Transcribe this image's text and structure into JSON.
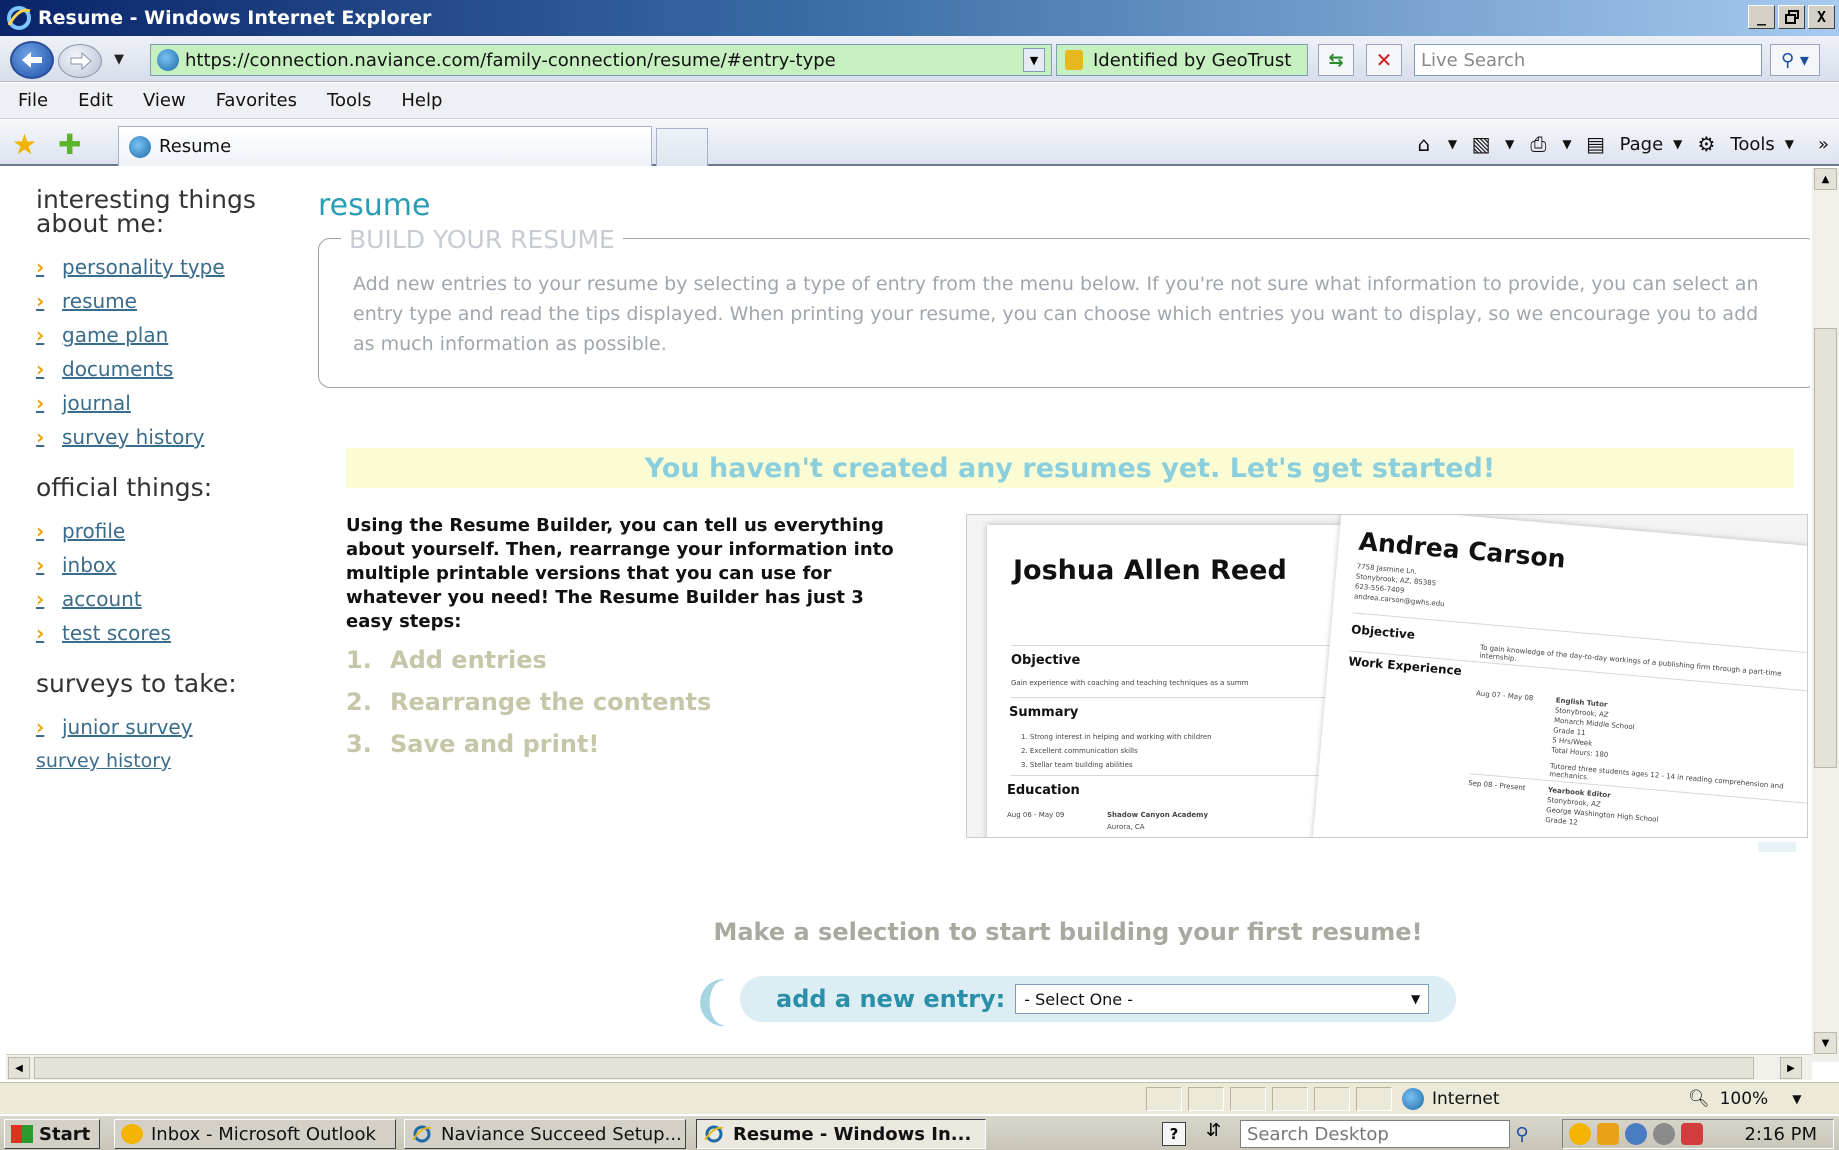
{
  "window": {
    "title": "Resume - Windows Internet Explorer",
    "buttons": {
      "minimize": "_",
      "maximize": "▫",
      "close": "X"
    }
  },
  "address": {
    "url": "https://connection.naviance.com/family-connection/resume/#entry-type",
    "cert": "Identified by GeoTrust",
    "search_placeholder": "Live Search"
  },
  "menu": [
    "File",
    "Edit",
    "View",
    "Favorites",
    "Tools",
    "Help"
  ],
  "tabbar": {
    "tab_label": "Resume",
    "page_label": "Page",
    "tools_label": "Tools",
    "overflow": "»"
  },
  "sidebar": {
    "heading_interesting": "interesting things about me:",
    "interesting": [
      "personality type",
      "resume",
      "game plan",
      "documents",
      "journal",
      "survey history"
    ],
    "heading_official": "official things:",
    "official": [
      "profile",
      "inbox",
      "account",
      "test scores"
    ],
    "heading_surveys": "surveys to take:",
    "surveys": [
      "junior survey"
    ],
    "survey_history_link": "survey history"
  },
  "main": {
    "heading": "resume",
    "build_legend": "BUILD YOUR RESUME",
    "build_text": "Add new entries to your resume by selecting a type of entry from the menu below. If you're not sure what information to provide, you can select an entry type and read the tips displayed. When printing your resume, you can choose which entries you want to display, so we encourage you to add as much information as possible.",
    "banner": "You haven't created any resumes yet. Let's get started!",
    "intro": "Using the Resume Builder, you can tell us everything about yourself. Then, rearrange your information into multiple printable versions that you can use for whatever you need! The Resume Builder has just 3 easy steps:",
    "steps": [
      {
        "num": "1.",
        "label": "Add entries"
      },
      {
        "num": "2.",
        "label": "Rearrange the contents"
      },
      {
        "num": "3.",
        "label": "Save and print!"
      }
    ],
    "cta": "Make a selection to start building your first resume!",
    "add_entry_label": "add a new entry:",
    "select_value": "- Select One -"
  },
  "preview": {
    "sheet_a": {
      "name": "Joshua Allen Reed",
      "objective": "Objective",
      "objective_text": "Gain experience with coaching and teaching techniques as a summ",
      "summary": "Summary",
      "summary_items": [
        "1. Strong interest in helping and working with children",
        "2. Excellent communication skills",
        "3. Stellar team building abilities"
      ],
      "education": "Education",
      "edu_date": "Aug 06 - May 09",
      "edu_school": "Shadow Canyon Academy",
      "edu_city": "Aurora, CA"
    },
    "sheet_b": {
      "name": "Andrea Carson",
      "address_lines": [
        "7758 Jasmine Ln.",
        "Stonybrook, AZ, 85385",
        "623-556-7409",
        "andrea.carson@gwhs.edu"
      ],
      "objective": "Objective",
      "objective_text": "To gain knowledge of the day-to-day workings of a publishing firm through a part-time internship.",
      "work": "Work Experience",
      "job1_date": "Aug 07 - May 08",
      "job1_lines": [
        "English Tutor",
        "Stonybrook, AZ",
        "Monarch Middle School",
        "Grade 11",
        "5 Hrs/Week",
        "Total Hours: 180"
      ],
      "job1_desc": "Tutored three students ages 12 - 14 in reading comprehension and mechanics.",
      "job2_date": "Sep 08 - Present",
      "job2_lines": [
        "Yearbook Editor",
        "Stonybrook, AZ",
        "George Washington High School",
        "Grade 12"
      ]
    }
  },
  "status": {
    "zone": "Internet",
    "zoom": "100%"
  },
  "taskbar": {
    "start": "Start",
    "tasks": [
      "Inbox - Microsoft Outlook",
      "Naviance Succeed Setup...",
      "Resume - Windows In..."
    ],
    "help": "?",
    "search_placeholder": "Search Desktop",
    "clock": "2:16 PM"
  }
}
